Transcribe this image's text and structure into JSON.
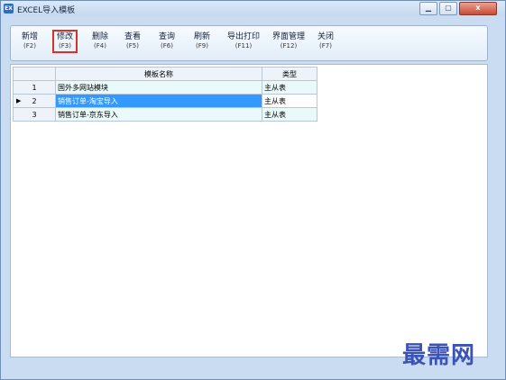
{
  "window": {
    "title": "EXCEL导入模板",
    "icon": "app-icon",
    "controls": [
      "minimize",
      "maximize",
      "close"
    ],
    "close_label": "x"
  },
  "toolbar": {
    "buttons": [
      {
        "label": "新增",
        "key": "(F2)"
      },
      {
        "label": "修改",
        "key": "(F3)"
      },
      {
        "label": "删除",
        "key": "(F4)"
      },
      {
        "label": "查看",
        "key": "(F5)"
      },
      {
        "label": "查询",
        "key": "(F6)"
      },
      {
        "label": "刷新",
        "key": "(F9)"
      },
      {
        "label": "导出打印",
        "key": "(F11)"
      },
      {
        "label": "界面管理",
        "key": "(F12)"
      },
      {
        "label": "关闭",
        "key": "(F7)"
      }
    ]
  },
  "grid": {
    "columns": [
      "",
      "模板名称",
      "类型"
    ],
    "rows": [
      {
        "num": "1",
        "name": "国外多网站模块",
        "type": "主从表"
      },
      {
        "num": "2",
        "name": "销售订单-淘宝导入",
        "type": "主从表"
      },
      {
        "num": "3",
        "name": "销售订单-京东导入",
        "type": "主从表"
      }
    ],
    "selected_row": 2
  },
  "watermark": "最需网",
  "colors": {
    "selection": "#3399ff",
    "highlight_border": "#d9302a"
  }
}
